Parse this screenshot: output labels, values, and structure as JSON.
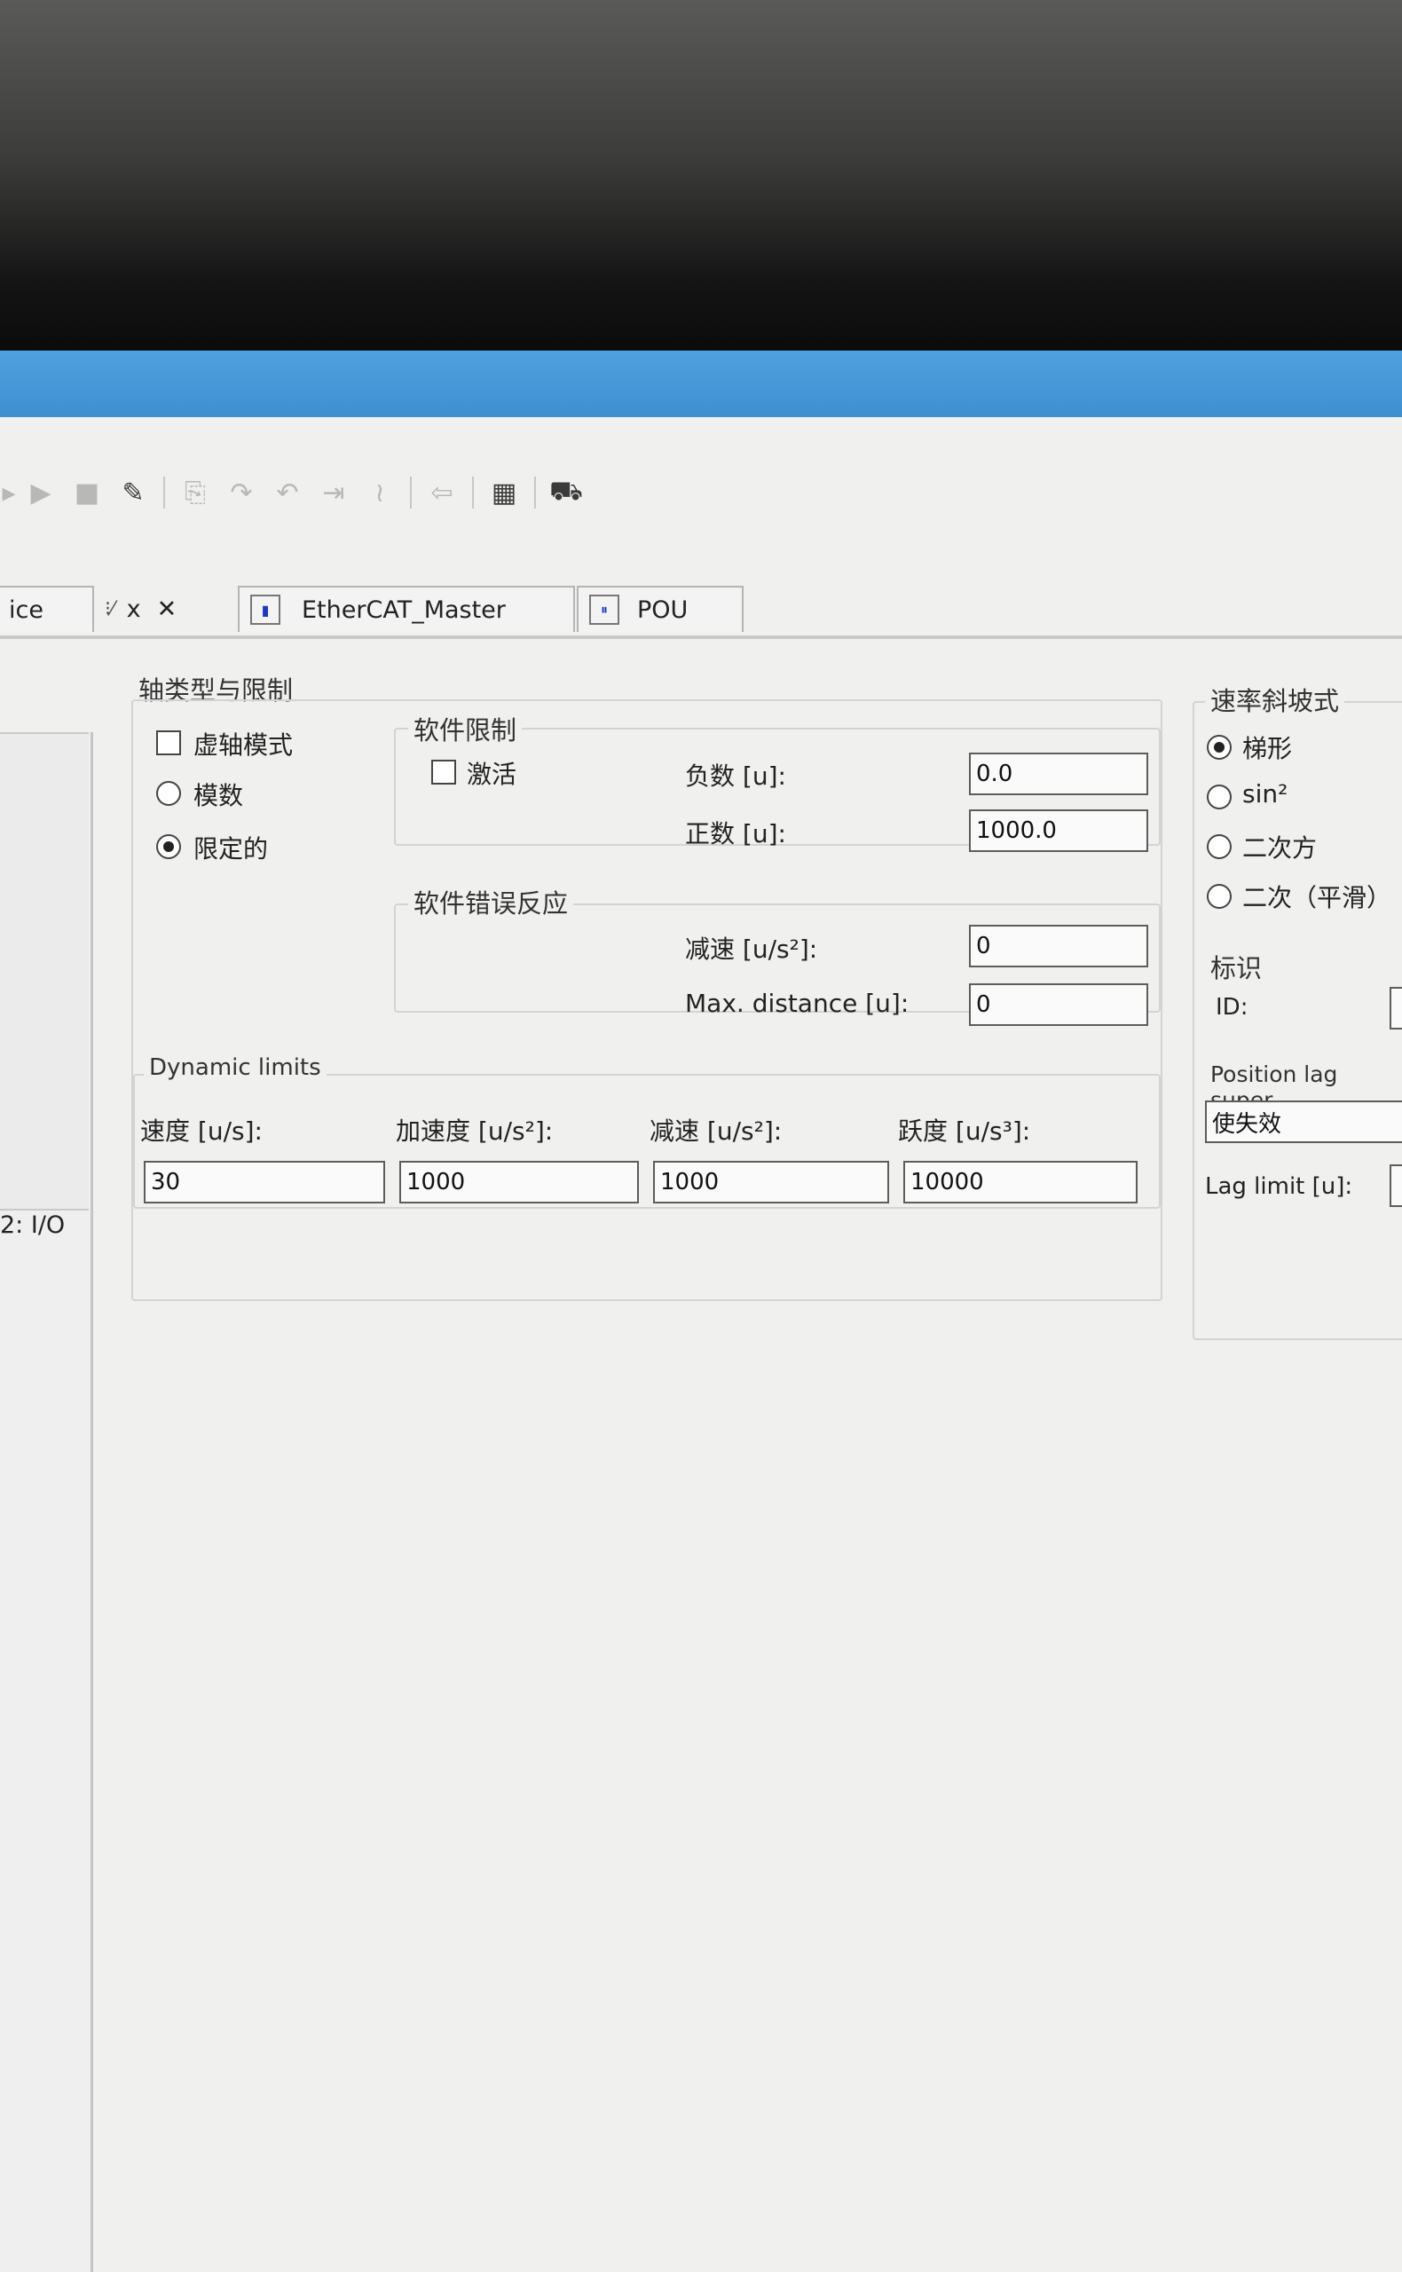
{
  "tabs": {
    "device_partial": "ice",
    "x1": "x",
    "x2": "✕",
    "ethercat": "EtherCAT_Master",
    "pou": "POU"
  },
  "left_panel": {
    "io_label": "2: I/O"
  },
  "axis_type": {
    "title": "轴类型与限制",
    "virtual_mode": "虚轴模式",
    "modulo": "模数",
    "finite": "限定的",
    "selected": "finite"
  },
  "software_limits": {
    "title": "软件限制",
    "activate": "激活",
    "negative_label": "负数 [u]:",
    "negative_value": "0.0",
    "positive_label": "正数 [u]:",
    "positive_value": "1000.0"
  },
  "software_error": {
    "title": "软件错误反应",
    "decel_label": "减速 [u/s²]:",
    "decel_value": "0",
    "maxdist_label": "Max. distance [u]:",
    "maxdist_value": "0"
  },
  "dynamic_limits": {
    "title": "Dynamic limits",
    "velocity_label": "速度 [u/s]:",
    "velocity_value": "30",
    "accel_label": "加速度 [u/s²]:",
    "accel_value": "1000",
    "decel_label": "减速 [u/s²]:",
    "decel_value": "1000",
    "jerk_label": "跃度 [u/s³]:",
    "jerk_value": "10000"
  },
  "ramp_type": {
    "title": "速率斜坡式",
    "trapezoid": "梯形",
    "sin2": "sin²",
    "quadratic": "二次方",
    "quadratic_smooth": "二次（平滑）",
    "selected": "trapezoid"
  },
  "identification": {
    "title": "标识",
    "id_label": "ID:"
  },
  "position_lag": {
    "title": "Position lag super",
    "mode_value": "使失效",
    "lag_limit_label": "Lag limit [u]:"
  },
  "colors": {
    "titlebar": "#4fa1de",
    "background": "#f0f0ef",
    "field_border": "#5c5c5c"
  }
}
